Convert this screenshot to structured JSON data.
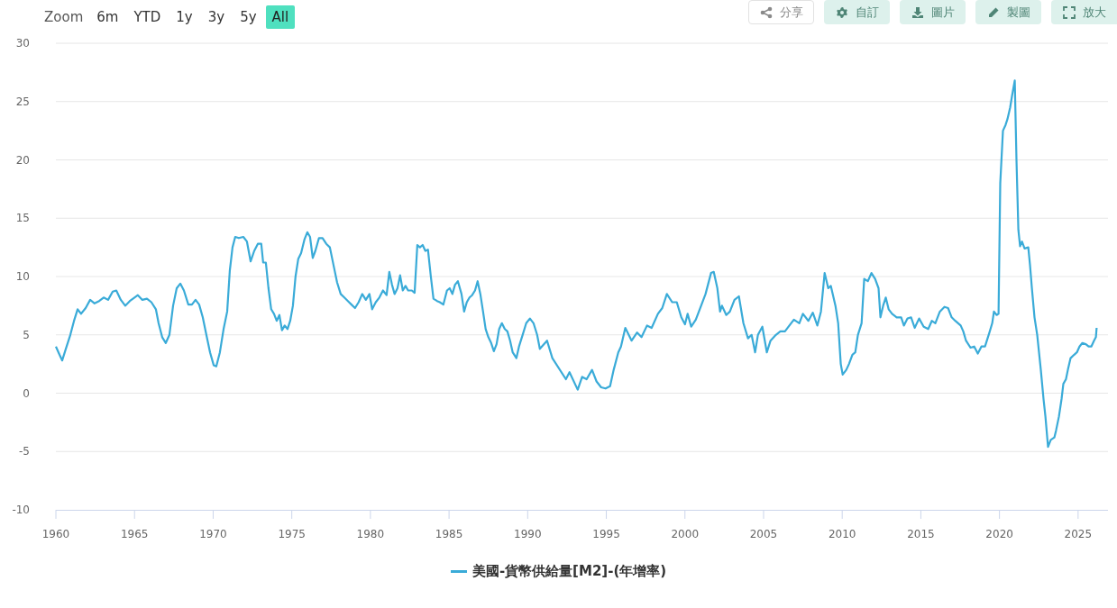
{
  "range_selector": {
    "label": "Zoom",
    "buttons": [
      {
        "label": "6m",
        "selected": false
      },
      {
        "label": "YTD",
        "selected": false
      },
      {
        "label": "1y",
        "selected": false
      },
      {
        "label": "3y",
        "selected": false
      },
      {
        "label": "5y",
        "selected": false
      },
      {
        "label": "All",
        "selected": true
      }
    ]
  },
  "toolbar": [
    {
      "label": "分享",
      "kind": "outline"
    },
    {
      "label": "自訂",
      "kind": "filled"
    },
    {
      "label": "圖片",
      "kind": "filled"
    },
    {
      "label": "製圖",
      "kind": "filled"
    },
    {
      "label": "放大",
      "kind": "filled"
    }
  ],
  "chart": {
    "chart_data": {
      "type": "line",
      "grid": true,
      "xlim": [
        1960,
        2026.9
      ],
      "ylim": [
        -10,
        30
      ],
      "xticks": [
        1960,
        1965,
        1970,
        1975,
        1980,
        1985,
        1990,
        1995,
        2000,
        2005,
        2010,
        2015,
        2020,
        2025
      ],
      "yticks": [
        -10,
        -5,
        0,
        5,
        10,
        15,
        20,
        25,
        30
      ],
      "x": [
        1960.0,
        1960.23,
        1960.4,
        1960.63,
        1960.92,
        1961.15,
        1961.38,
        1961.6,
        1961.89,
        1962.18,
        1962.46,
        1962.75,
        1963.04,
        1963.32,
        1963.61,
        1963.84,
        1964.13,
        1964.41,
        1964.7,
        1965.0,
        1965.21,
        1965.5,
        1965.79,
        1966.07,
        1966.36,
        1966.53,
        1966.76,
        1966.99,
        1967.22,
        1967.45,
        1967.68,
        1967.91,
        1968.14,
        1968.42,
        1968.65,
        1968.88,
        1969.11,
        1969.34,
        1969.57,
        1969.8,
        1970.03,
        1970.2,
        1970.43,
        1970.66,
        1970.89,
        1971.06,
        1971.23,
        1971.4,
        1971.63,
        1971.92,
        1972.15,
        1972.38,
        1972.61,
        1972.84,
        1973.06,
        1973.18,
        1973.35,
        1973.52,
        1973.69,
        1973.87,
        1974.04,
        1974.21,
        1974.38,
        1974.55,
        1974.73,
        1974.9,
        1975.07,
        1975.24,
        1975.41,
        1975.59,
        1975.81,
        1975.99,
        1976.16,
        1976.33,
        1976.5,
        1976.73,
        1976.96,
        1977.19,
        1977.42,
        1977.65,
        1977.88,
        1978.11,
        1978.34,
        1978.57,
        1978.79,
        1979.02,
        1979.25,
        1979.48,
        1979.71,
        1979.94,
        1980.11,
        1980.34,
        1980.57,
        1980.8,
        1981.03,
        1981.2,
        1981.37,
        1981.54,
        1981.72,
        1981.89,
        1982.06,
        1982.23,
        1982.4,
        1982.63,
        1982.81,
        1982.98,
        1983.15,
        1983.32,
        1983.49,
        1983.66,
        1983.84,
        1984.01,
        1984.24,
        1984.41,
        1984.64,
        1984.87,
        1985.04,
        1985.21,
        1985.38,
        1985.56,
        1985.79,
        1985.96,
        1986.13,
        1986.3,
        1986.47,
        1986.65,
        1986.82,
        1986.99,
        1987.16,
        1987.33,
        1987.5,
        1987.68,
        1987.85,
        1988.02,
        1988.19,
        1988.36,
        1988.54,
        1988.71,
        1988.88,
        1989.05,
        1989.28,
        1989.45,
        1989.68,
        1989.91,
        1990.14,
        1990.37,
        1990.6,
        1990.77,
        1991.23,
        1991.57,
        1992.43,
        1992.66,
        1993.18,
        1993.46,
        1993.75,
        1994.09,
        1994.38,
        1994.67,
        1994.95,
        1995.24,
        1995.47,
        1995.76,
        1995.93,
        1996.21,
        1996.61,
        1996.96,
        1997.24,
        1997.59,
        1997.88,
        1998.28,
        1998.56,
        1998.85,
        1999.19,
        1999.48,
        1999.77,
        2000.0,
        2000.17,
        2000.4,
        2000.69,
        2001.03,
        2001.31,
        2001.66,
        2001.83,
        2002.06,
        2002.23,
        2002.35,
        2002.63,
        2002.86,
        2003.15,
        2003.43,
        2003.72,
        2004.01,
        2004.24,
        2004.46,
        2004.64,
        2004.92,
        2005.21,
        2005.44,
        2005.78,
        2006.07,
        2006.36,
        2006.64,
        2006.93,
        2007.27,
        2007.5,
        2007.85,
        2008.13,
        2008.42,
        2008.65,
        2008.88,
        2009.11,
        2009.28,
        2009.57,
        2009.74,
        2009.91,
        2010.03,
        2010.26,
        2010.43,
        2010.65,
        2010.83,
        2011.0,
        2011.23,
        2011.4,
        2011.63,
        2011.86,
        2012.09,
        2012.31,
        2012.43,
        2012.6,
        2012.77,
        2012.95,
        2013.17,
        2013.46,
        2013.75,
        2013.92,
        2014.15,
        2014.38,
        2014.61,
        2014.89,
        2015.18,
        2015.47,
        2015.7,
        2015.92,
        2016.21,
        2016.5,
        2016.73,
        2016.96,
        2017.19,
        2017.53,
        2017.7,
        2017.87,
        2018.16,
        2018.39,
        2018.62,
        2018.85,
        2019.08,
        2019.36,
        2019.54,
        2019.65,
        2019.82,
        2019.94,
        2020.05,
        2020.22,
        2020.39,
        2020.51,
        2020.68,
        2020.8,
        2020.97,
        2021.08,
        2021.2,
        2021.31,
        2021.43,
        2021.6,
        2021.83,
        2021.94,
        2022.06,
        2022.23,
        2022.4,
        2022.63,
        2022.8,
        2022.92,
        2023.09,
        2023.26,
        2023.49,
        2023.6,
        2023.78,
        2023.95,
        2024.06,
        2024.23,
        2024.35,
        2024.52,
        2024.75,
        2024.92,
        2025.09,
        2025.27,
        2025.49,
        2025.67,
        2025.84,
        2026.01,
        2026.13,
        2026.18
      ],
      "series": [
        {
          "name": "美國-貨幣供給量[M2]-(年增率)",
          "color": "#3aabd8",
          "values": [
            4.0,
            3.3,
            2.8,
            3.8,
            5.0,
            6.2,
            7.2,
            6.8,
            7.3,
            8.0,
            7.7,
            7.9,
            8.2,
            8.0,
            8.7,
            8.8,
            8.0,
            7.5,
            7.9,
            8.2,
            8.4,
            8.0,
            8.1,
            7.8,
            7.2,
            6.0,
            4.8,
            4.3,
            5.0,
            7.5,
            9.0,
            9.4,
            8.8,
            7.6,
            7.6,
            8.0,
            7.6,
            6.5,
            5.0,
            3.5,
            2.4,
            2.3,
            3.5,
            5.5,
            7.0,
            10.5,
            12.5,
            13.4,
            13.3,
            13.4,
            13.0,
            11.3,
            12.2,
            12.8,
            12.8,
            11.2,
            11.2,
            9.0,
            7.2,
            6.8,
            6.2,
            6.7,
            5.4,
            5.8,
            5.5,
            6.2,
            7.5,
            10.0,
            11.5,
            12.0,
            13.2,
            13.8,
            13.4,
            11.6,
            12.2,
            13.3,
            13.3,
            12.8,
            12.5,
            11.0,
            9.5,
            8.5,
            8.2,
            7.9,
            7.6,
            7.3,
            7.8,
            8.5,
            8.0,
            8.5,
            7.2,
            7.8,
            8.2,
            8.8,
            8.4,
            10.4,
            9.3,
            8.5,
            9.0,
            10.1,
            8.8,
            9.2,
            8.8,
            8.8,
            8.6,
            12.7,
            12.5,
            12.7,
            12.2,
            12.3,
            10.0,
            8.1,
            7.9,
            7.8,
            7.6,
            8.8,
            9.0,
            8.5,
            9.3,
            9.6,
            8.5,
            7.0,
            7.8,
            8.2,
            8.4,
            8.8,
            9.6,
            8.5,
            7.0,
            5.5,
            4.8,
            4.3,
            3.6,
            4.2,
            5.5,
            6.0,
            5.5,
            5.3,
            4.5,
            3.5,
            3.0,
            4.0,
            5.0,
            6.0,
            6.4,
            6.0,
            5.0,
            3.8,
            4.5,
            3.0,
            1.2,
            1.8,
            0.3,
            1.4,
            1.2,
            2.0,
            1.0,
            0.5,
            0.4,
            0.6,
            2.0,
            3.5,
            4.0,
            5.6,
            4.5,
            5.2,
            4.8,
            5.8,
            5.6,
            6.8,
            7.3,
            8.5,
            7.8,
            7.8,
            6.5,
            5.9,
            6.8,
            5.7,
            6.3,
            7.5,
            8.5,
            10.3,
            10.4,
            9.0,
            7.0,
            7.5,
            6.7,
            7.0,
            8.0,
            8.3,
            6.0,
            4.7,
            5.0,
            3.5,
            5.0,
            5.7,
            3.5,
            4.5,
            5.0,
            5.3,
            5.3,
            5.8,
            6.3,
            6.0,
            6.8,
            6.2,
            6.9,
            5.8,
            7.0,
            10.3,
            9.0,
            9.2,
            7.5,
            6.0,
            2.5,
            1.6,
            2.0,
            2.5,
            3.3,
            3.5,
            5.0,
            6.0,
            9.8,
            9.6,
            10.3,
            9.8,
            9.0,
            6.5,
            7.5,
            8.2,
            7.2,
            6.8,
            6.5,
            6.5,
            5.8,
            6.4,
            6.5,
            5.6,
            6.4,
            5.7,
            5.5,
            6.2,
            6.0,
            7.0,
            7.4,
            7.3,
            6.5,
            6.2,
            5.8,
            5.3,
            4.5,
            3.9,
            4.0,
            3.4,
            4.0,
            4.0,
            5.2,
            6.0,
            7.0,
            6.7,
            6.8,
            18,
            22.5,
            23.0,
            23.5,
            24.5,
            25.5,
            26.8,
            20,
            14,
            12.6,
            13.0,
            12.4,
            12.5,
            11,
            9,
            6.5,
            5.0,
            2.0,
            -0.5,
            -2.0,
            -4.6,
            -4.0,
            -3.8,
            -3.2,
            -2.0,
            -0.5,
            0.8,
            1.2,
            2.0,
            3.0,
            3.3,
            3.5,
            4.0,
            4.3,
            4.2,
            4.0,
            4.0,
            4.5,
            4.8,
            5.6
          ]
        }
      ]
    }
  }
}
